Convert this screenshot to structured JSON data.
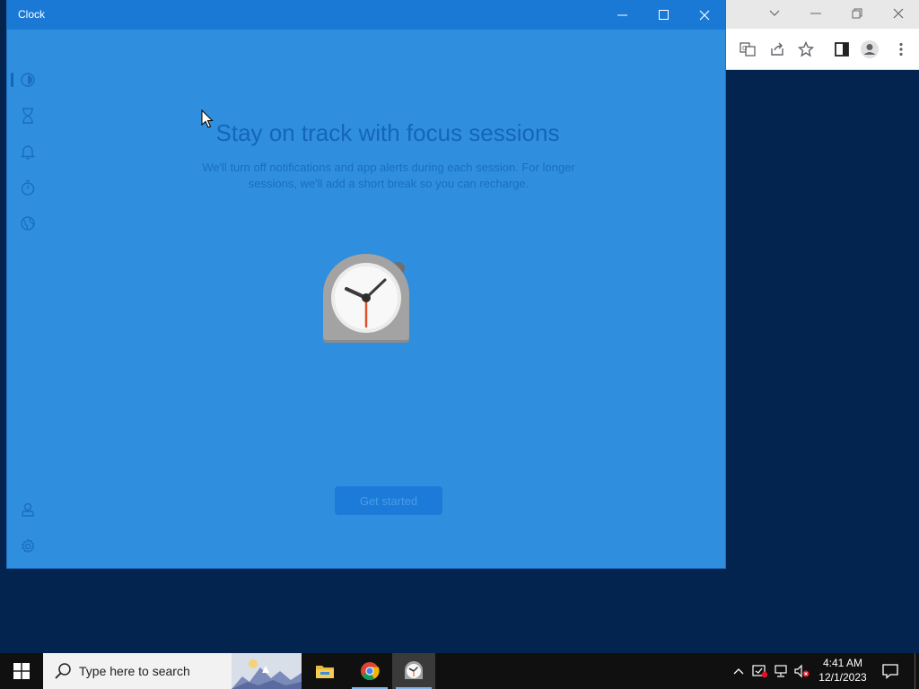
{
  "clock_app": {
    "title": "Clock",
    "heading": "Stay on track with focus sessions",
    "description": "We'll turn off notifications and app alerts during each session. For longer sessions, we'll add a short break so you can recharge.",
    "get_started_label": "Get started",
    "nav": [
      "focus-sessions-icon",
      "timer-icon",
      "alarm-icon",
      "stopwatch-icon",
      "world-clock-icon"
    ],
    "nav_bottom": [
      "account-icon",
      "settings-icon"
    ]
  },
  "taskbar": {
    "search_placeholder": "Type here to search",
    "apps": [
      "file-explorer-icon",
      "chrome-icon",
      "clock-app-icon"
    ],
    "time": "4:41 AM",
    "date": "12/1/2023"
  },
  "colors": {
    "window_bg": "#2f8fde",
    "titlebar": "#1b79d6",
    "heading": "#1565b8",
    "desktop": "#02244f",
    "taskbar": "#101010"
  }
}
